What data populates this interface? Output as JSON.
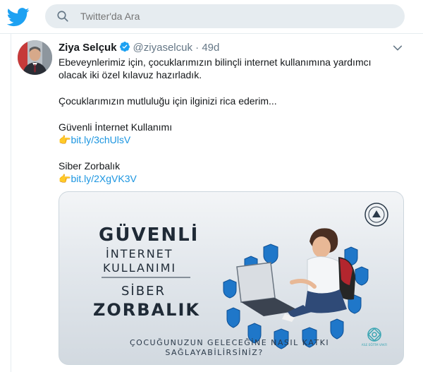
{
  "header": {
    "search_placeholder": "Twitter'da Ara",
    "brand_color": "#1da1f2"
  },
  "tweet": {
    "author_name": "Ziya Selçuk",
    "handle": "@ziyaselcuk",
    "separator": "·",
    "time": "49d",
    "lines": {
      "l1": "Ebeveynlerimiz için, çocuklarımızın bilinçli internet kullanımına yardımcı",
      "l2": "olacak iki özel kılavuz hazırladık.",
      "l3": "Çocuklarımızın mutluluğu için ilginizi rica ederim...",
      "l4": "Güvenli İnternet Kullanımı",
      "l5": "Siber Zorbalık"
    },
    "link1": "bit.ly/3chUlsV",
    "link2": "bit.ly/2XgVK3V",
    "pointing_emoji": "👉",
    "link_color": "#1b95e0"
  },
  "media": {
    "title_line1": "GÜVENLİ",
    "title_line2": "İNTERNET",
    "title_line3": "KULLANIMI",
    "title_line4": "SİBER",
    "title_line5": "ZORBALIK",
    "subtitle_line1": "ÇOCUĞUNUZUN GELECEĞİNE NASIL KATKI",
    "subtitle_line2": "SAĞLAYABİLİRSİNİZ?",
    "logo_text": "AİLE EĞİTİM VAKFI"
  }
}
